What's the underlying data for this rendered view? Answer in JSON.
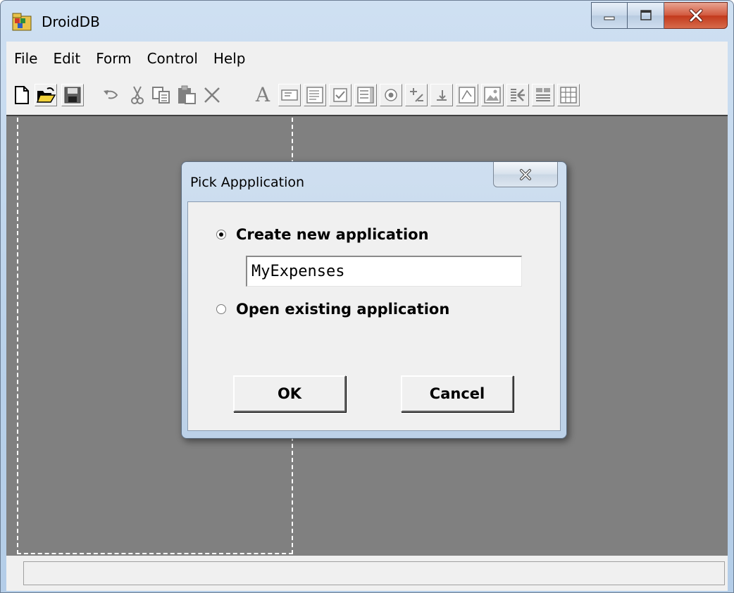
{
  "window": {
    "title": "DroidDB",
    "app_icon": "droiddb-app-icon",
    "controls": [
      "minimize-icon",
      "maximize-icon",
      "close-icon"
    ]
  },
  "menubar": {
    "items": [
      "File",
      "Edit",
      "Form",
      "Control",
      "Help"
    ]
  },
  "toolbar": {
    "buttons": [
      {
        "name": "new-file-icon"
      },
      {
        "name": "open-folder-icon"
      },
      {
        "name": "save-icon"
      },
      {
        "name": "undo-icon"
      },
      {
        "name": "cut-icon"
      },
      {
        "name": "copy-icon"
      },
      {
        "name": "paste-icon"
      },
      {
        "name": "delete-icon"
      },
      {
        "name": "label-tool-icon",
        "glyph": "A"
      },
      {
        "name": "textbox-tool-icon"
      },
      {
        "name": "multiline-text-tool-icon"
      },
      {
        "name": "checkbox-tool-icon"
      },
      {
        "name": "listbox-tool-icon"
      },
      {
        "name": "radio-tool-icon"
      },
      {
        "name": "spinner-tool-icon"
      },
      {
        "name": "button-tool-icon"
      },
      {
        "name": "combo-tool-icon"
      },
      {
        "name": "image-tool-icon"
      },
      {
        "name": "insert-tool-icon"
      },
      {
        "name": "layout-tool-icon"
      },
      {
        "name": "grid-tool-icon"
      }
    ]
  },
  "dialog": {
    "title": "Pick Appplication",
    "options": {
      "create_label": "Create new application",
      "open_label": "Open existing application",
      "selected": "create"
    },
    "app_name_value": "MyExpenses",
    "ok_label": "OK",
    "cancel_label": "Cancel"
  },
  "statusbar": {
    "text": ""
  }
}
